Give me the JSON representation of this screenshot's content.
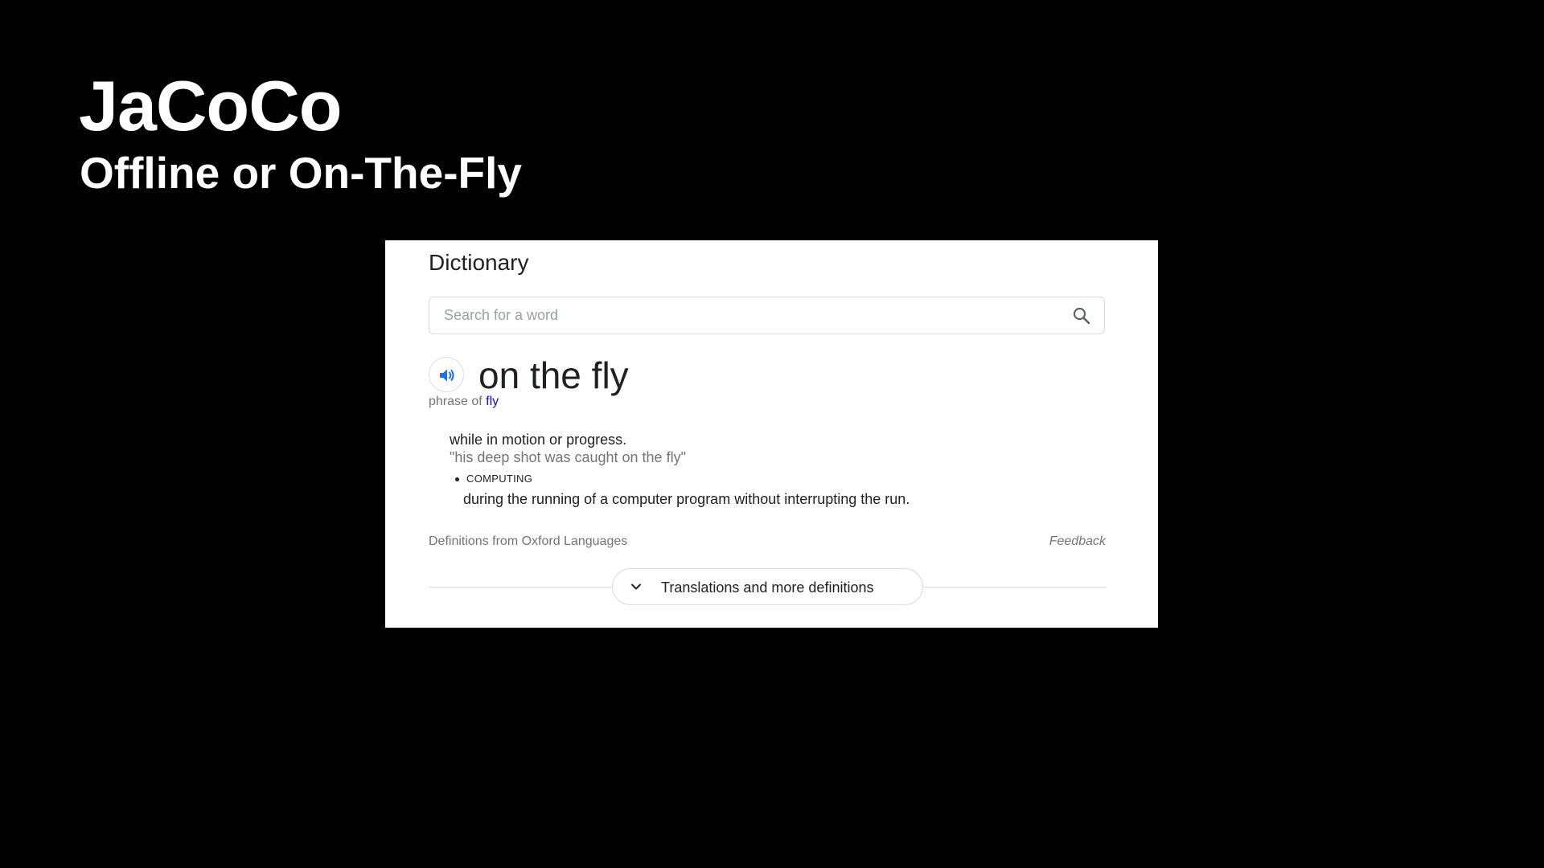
{
  "slide": {
    "title": "JaCoCo",
    "subtitle": "Offline or On-The-Fly"
  },
  "dictionary": {
    "heading": "Dictionary",
    "search": {
      "placeholder": "Search for a word",
      "value": ""
    },
    "entry": {
      "word": "on the fly",
      "phrase_prefix": "phrase of",
      "phrase_link": "fly",
      "senses": [
        {
          "definition": "while in motion or progress.",
          "example": "\"his deep shot was caught on the fly\""
        },
        {
          "label": "COMPUTING",
          "definition": "during the running of a computer program without interrupting the run."
        }
      ]
    },
    "source": "Definitions from Oxford Languages",
    "feedback": "Feedback",
    "more_button": "Translations and more definitions"
  },
  "colors": {
    "background": "#000000",
    "card": "#ffffff",
    "link": "#1a0dab",
    "speaker_icon": "#1a73e8",
    "muted_text": "#70757a",
    "border": "#dadce0"
  },
  "icons": {
    "search": "search-icon",
    "speaker": "speaker-icon",
    "chevron": "chevron-down-icon"
  }
}
